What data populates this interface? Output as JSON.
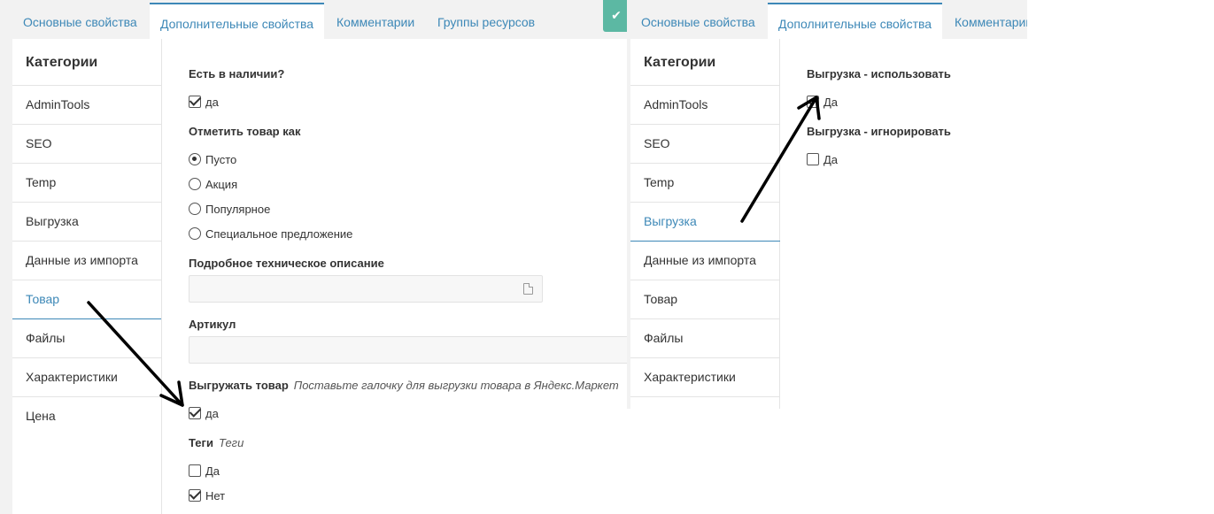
{
  "left": {
    "tabs": [
      "Основные свойства",
      "Дополнительные свойства",
      "Комментарии",
      "Группы ресурсов"
    ],
    "save_icon": "✔",
    "sidebar": {
      "title": "Категории",
      "items": [
        "AdminTools",
        "SEO",
        "Temp",
        "Выгрузка",
        "Данные из импорта",
        "Товар",
        "Файлы",
        "Характеристики",
        "Цена"
      ],
      "active": "Товар"
    },
    "form": {
      "in_stock_label": "Есть в наличии?",
      "in_stock_option": "да",
      "in_stock_checked": true,
      "mark_label": "Отметить товар как",
      "mark_options": [
        "Пусто",
        "Акция",
        "Популярное",
        "Специальное предложение"
      ],
      "mark_selected": "Пусто",
      "description_label": "Подробное техническое описание",
      "description_value": "",
      "sku_label": "Артикул",
      "sku_value": "",
      "export_label": "Выгружать товар",
      "export_hint": "Поставьте галочку для выгрузки товара в Яндекс.Маркет",
      "export_option": "да",
      "export_checked": true,
      "tags_label": "Теги",
      "tags_hint": "Теги",
      "tags_yes": "Да",
      "tags_yes_checked": false,
      "tags_no": "Нет",
      "tags_no_checked": true
    }
  },
  "right": {
    "tabs": [
      "Основные свойства",
      "Дополнительные свойства",
      "Комментарии"
    ],
    "sidebar": {
      "title": "Категории",
      "items": [
        "AdminTools",
        "SEO",
        "Temp",
        "Выгрузка",
        "Данные из импорта",
        "Товар",
        "Файлы",
        "Характеристики"
      ],
      "active": "Выгрузка"
    },
    "form": {
      "use_label": "Выгрузка - использовать",
      "use_option": "Да",
      "use_checked": true,
      "ignore_label": "Выгрузка - игнорировать",
      "ignore_option": "Да",
      "ignore_checked": false
    }
  },
  "colors": {
    "accent": "#3d88b7",
    "save_button": "#5cb8a3",
    "background": "#f2f2f2",
    "annotation_arrow": "#000000"
  }
}
